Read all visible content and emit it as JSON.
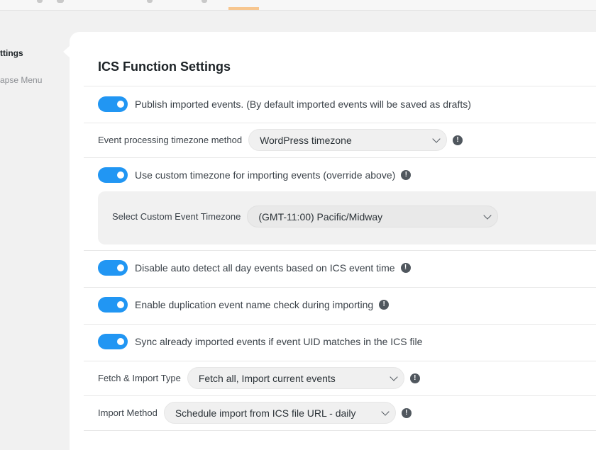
{
  "sidebar": {
    "settings_label": "ttings",
    "collapse_label": "apse Menu"
  },
  "panel": {
    "title": "ICS Function Settings"
  },
  "options": {
    "publish_imported": {
      "label": "Publish imported events. (By default imported events will be saved as drafts)",
      "enabled": true
    },
    "timezone_method": {
      "label": "Event processing timezone method",
      "value": "WordPress timezone"
    },
    "custom_timezone": {
      "label": "Use custom timezone for importing events (override above)",
      "enabled": true
    },
    "custom_event_timezone": {
      "label": "Select Custom Event Timezone",
      "value": "(GMT-11:00) Pacific/Midway"
    },
    "disable_allday_detect": {
      "label": "Disable auto detect all day events based on ICS event time",
      "enabled": true
    },
    "duplication_check": {
      "label": "Enable duplication event name check during importing",
      "enabled": true
    },
    "sync_uid": {
      "label": "Sync already imported events if event UID matches in the ICS file",
      "enabled": true
    },
    "fetch_import_type": {
      "label": "Fetch & Import Type",
      "value": "Fetch all, Import current events"
    },
    "import_method": {
      "label": "Import Method",
      "value": "Schedule import from ICS file URL - daily"
    }
  },
  "icons": {
    "info": "!"
  },
  "colors": {
    "toggle_on": "#2196f3",
    "active_tab": "#f7c68f"
  }
}
